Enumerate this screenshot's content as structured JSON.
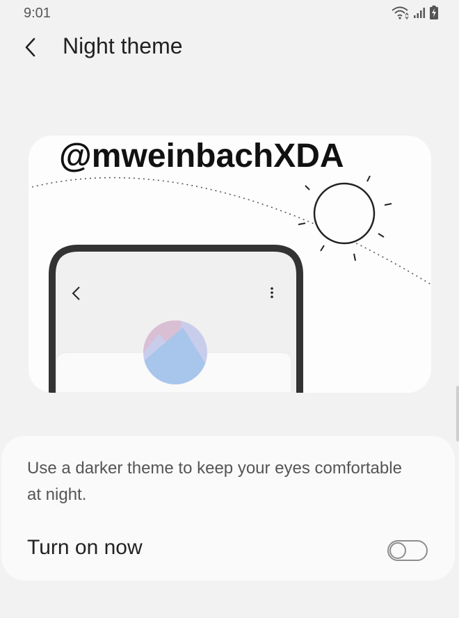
{
  "status_bar": {
    "time": "9:01",
    "icons": [
      "wifi-icon",
      "signal-icon",
      "battery-charging-icon"
    ]
  },
  "header": {
    "back_icon": "back-arrow-icon",
    "title": "Night theme"
  },
  "illustration": {
    "watermark": "@mweinbachXDA",
    "icons": [
      "sun-icon",
      "phone-back-icon",
      "more-options-icon",
      "color-circle-icon"
    ],
    "colors": {
      "pink": "#d9bfd4",
      "blue": "#a8c5ec",
      "lavender": "#c9cdec"
    }
  },
  "settings": {
    "description": "Use a darker theme to keep your eyes comfortable at night.",
    "toggle_label": "Turn on now",
    "toggle_on": false
  }
}
